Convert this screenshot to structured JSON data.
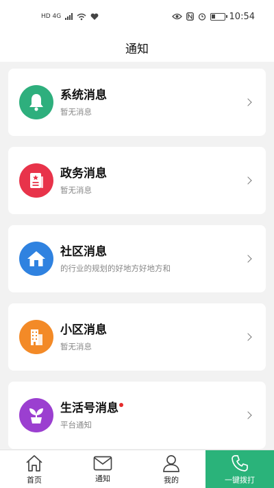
{
  "status_bar": {
    "left_text": "HD 4G",
    "time": "10:54"
  },
  "header": {
    "title": "通知"
  },
  "messages": [
    {
      "title": "系统消息",
      "subtitle": "暂无消息",
      "icon": "bell-icon",
      "color": "#2eaf7d",
      "unread": false
    },
    {
      "title": "政务消息",
      "subtitle": "暂无消息",
      "icon": "document-icon",
      "color": "#e8334a",
      "unread": false
    },
    {
      "title": "社区消息",
      "subtitle": "的行业的规划的好地方好地方和",
      "icon": "home-icon",
      "color": "#2f82e0",
      "unread": false
    },
    {
      "title": "小区消息",
      "subtitle": "暂无消息",
      "icon": "building-icon",
      "color": "#f38a27",
      "unread": false
    },
    {
      "title": "生活号消息",
      "subtitle": "平台通知",
      "icon": "plant-icon",
      "color": "#9b3fd0",
      "unread": true
    }
  ],
  "tabbar": {
    "tabs": [
      {
        "label": "首页",
        "icon": "home-outline-icon"
      },
      {
        "label": "通知",
        "icon": "mail-icon"
      },
      {
        "label": "我的",
        "icon": "user-icon"
      },
      {
        "label": "一键拨打",
        "icon": "phone-icon"
      }
    ]
  }
}
